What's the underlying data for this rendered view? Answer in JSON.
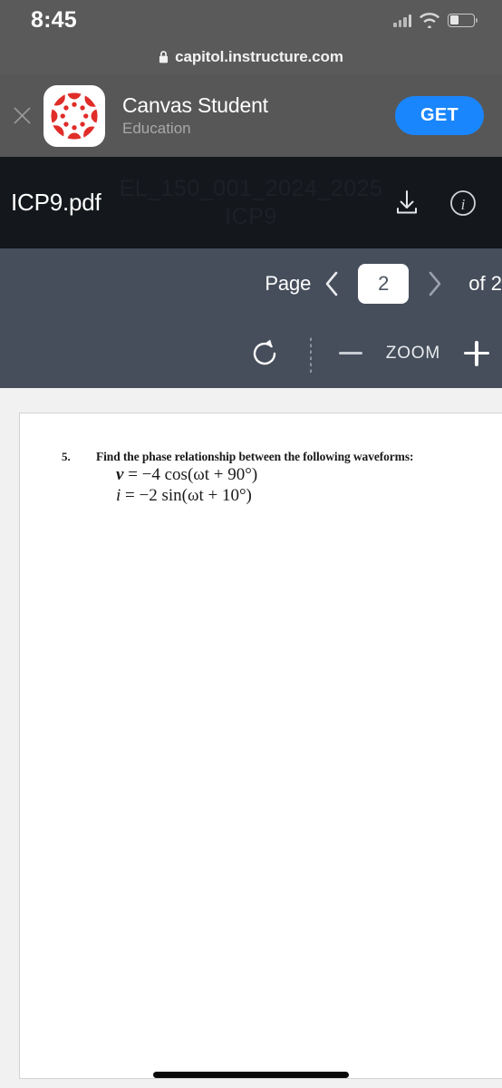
{
  "status_bar": {
    "time": "8:45",
    "signal_icon": "cellular-signal-icon",
    "wifi_icon": "wifi-icon",
    "battery_icon": "battery-icon",
    "battery_level_percent": 38
  },
  "browser": {
    "url": "capitol.instructure.com",
    "lock_icon": "lock-icon"
  },
  "smart_banner": {
    "close_icon": "close-icon",
    "app_icon": "canvas-logo-icon",
    "app_name": "Canvas Student",
    "app_category": "Education",
    "cta_label": "GET",
    "cta_color": "#1a86fd"
  },
  "pdf_header": {
    "filename": "ICP9.pdf",
    "watermark_line1": "EL_150_001_2024_2025",
    "watermark_line2": "ICP9",
    "download_icon": "download-icon",
    "info_icon": "info-icon",
    "background_color": "#14171b"
  },
  "pdf_toolbar": {
    "background_color": "#464e5b",
    "page_label": "Page",
    "prev_icon": "chevron-left-icon",
    "next_icon": "chevron-right-icon",
    "current_page": "2",
    "total_pages_label": "of 2",
    "rotate_icon": "rotate-icon",
    "zoom_out_icon": "minus-icon",
    "zoom_label": "ZOOM",
    "zoom_in_icon": "plus-icon"
  },
  "document": {
    "problem_number": "5.",
    "problem_text": "Find the phase relationship between the following waveforms:",
    "equation_1_var": "v",
    "equation_1_body": " = −4 cos(ωt + 90°)",
    "equation_2_var": "i",
    "equation_2_body": " = −2 sin(ωt + 10°)"
  },
  "home_indicator": "home-indicator"
}
